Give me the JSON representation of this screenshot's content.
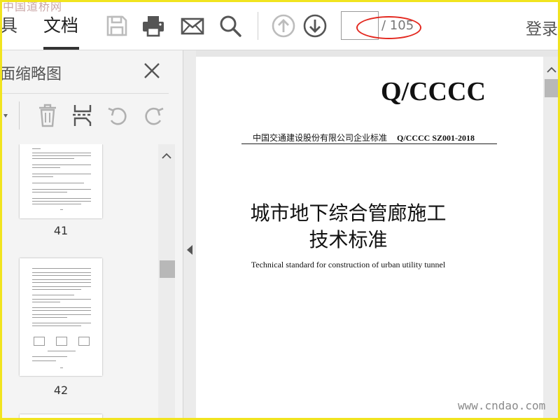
{
  "watermark_top": "中国道桥网",
  "watermark_bottom": "www.cndao.com",
  "toolbar": {
    "tab_tools": "具",
    "tab_document": "文档",
    "login_label": "登录",
    "icons": [
      "save-icon",
      "print-icon",
      "email-icon",
      "search-icon",
      "page-up-icon",
      "page-down-icon"
    ],
    "page_input_value": "",
    "page_total": "/ 105"
  },
  "sidebar": {
    "title": "面缩略图",
    "icons": [
      "dropdown-icon",
      "delete-icon",
      "insert-page-icon",
      "rotate-left-icon",
      "rotate-right-icon",
      "close-icon"
    ],
    "thumbnails": [
      {
        "label": "41"
      },
      {
        "label": "42"
      }
    ]
  },
  "document": {
    "code": "Q/CCCC",
    "subline_org": "中国交通建设股份有限公司企业标准",
    "subline_number": "Q/CCCC SZ001-2018",
    "title_line1": "城市地下综合管廊施工",
    "title_line2": "技术标准",
    "subtitle": "Technical standard for construction of urban utility tunnel"
  },
  "colors": {
    "frame": "#f1e41f",
    "highlight_oval": "#e3281f",
    "icon_gray": "#555555",
    "icon_disabled": "#bcbcbc"
  }
}
